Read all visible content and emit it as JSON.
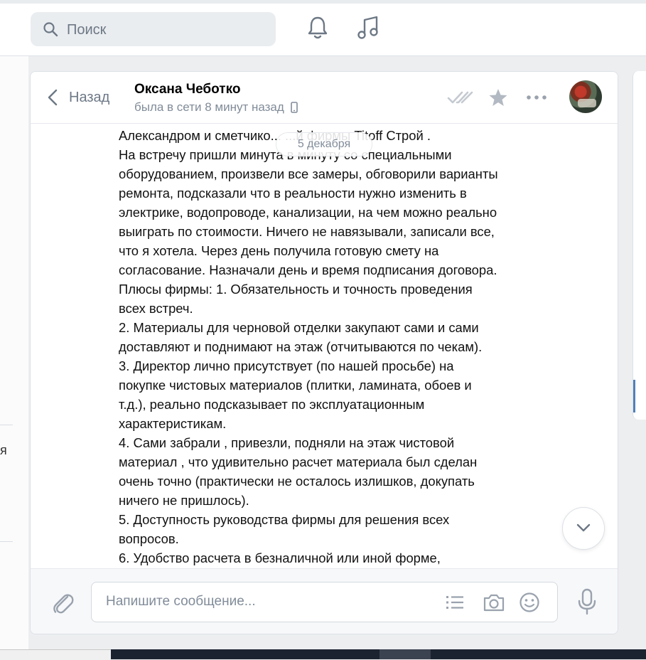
{
  "topbar": {
    "search_placeholder": "Поиск",
    "icons": [
      "search-icon",
      "bell-icon",
      "music-icon"
    ]
  },
  "left_strip": {
    "partial_text": "я"
  },
  "chat": {
    "back_label": "Назад",
    "contact_name": "Оксана Чеботко",
    "status": "была в сети 8 минут назад",
    "header_icons": [
      "double-check-icon",
      "star-icon",
      "more-icon",
      "avatar"
    ],
    "date_pill": "5 декабря",
    "message_lines": [
      "Александром и сметчико... ...й фирмы Titoff Строй .",
      "На встречу пришли минута в минуту со специальными",
      "оборудованием, произвели все замеры, обговорили варианты",
      "ремонта, подсказали что в реальности нужно изменить в",
      "электрике, водопроводе, канализации, на чем можно реально",
      "выиграть по стоимости. Ничего не навязывали, записали все,",
      "что я хотела. Через день получила готовую смету на",
      "согласование. Назначали день и время подписания договора.",
      "Плюсы фирмы: 1. Обязательность и точность проведения",
      "всех встреч.",
      "2. Материалы для черновой отделки закупают сами и сами",
      "доставляют и поднимают на этаж (отчитываются по чекам).",
      "3. Директор лично присутствует (по нашей просьбе) на",
      "покупке чистовых материалов (плитки, ламината, обоев и",
      "т.д.), реально подсказывает по эксплуатационным",
      "характеристикам.",
      "4. Сами забрали , привезли, подняли на этаж чистовой",
      "материал , что удивительно расчет материала был сделан",
      "очень точно (практически не осталось излишков, докупать",
      "ничего не пришлось).",
      "5. Доступность руководства фирмы для решения всех",
      "вопросов.",
      "6. Удобство расчета в безналичной или иной форме,"
    ]
  },
  "composer": {
    "placeholder": "Напишите сообщение...",
    "icons": [
      "attach-icon",
      "template-list-icon",
      "camera-icon",
      "emoji-icon",
      "microphone-icon"
    ]
  },
  "colors": {
    "accent": "#5181b8",
    "muted": "#818c99",
    "background": "#edeef0"
  }
}
